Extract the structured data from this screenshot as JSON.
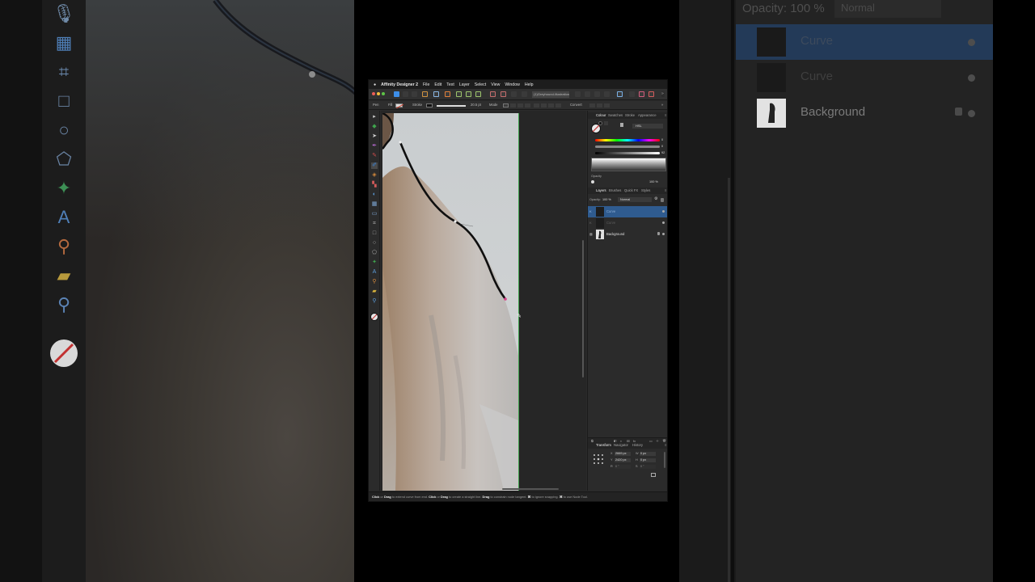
{
  "app": {
    "name": "Affinity Designer 2",
    "menu": [
      "File",
      "Edit",
      "Text",
      "Layer",
      "Select",
      "View",
      "Window",
      "Help"
    ],
    "document_name": "(1)Greyhound-illustration.af"
  },
  "context_toolbar": {
    "pen_label": "Pen",
    "fill_label": "Fill",
    "stroke_label": "Stroke",
    "stroke_width": "20.5 pt",
    "mode_label": "Mode",
    "convert_label": "Convert"
  },
  "colour_panel": {
    "tabs": [
      "Colour",
      "Swatches",
      "Stroke",
      "Appearance"
    ],
    "active_tab": "Colour",
    "model": "HSL",
    "h_value": "0",
    "s_value": "0",
    "l_value": "92",
    "opacity_label": "Opacity",
    "opacity_value": "100 %"
  },
  "layers_panel": {
    "tabs": [
      "Layers",
      "Brushes",
      "Quick FX",
      "Styles"
    ],
    "active_tab": "Layers",
    "opacity_label": "Opacity:",
    "opacity_value": "100 %",
    "blend_mode": "Normal",
    "layers": [
      {
        "name": "Curve",
        "selected": true,
        "dim": false
      },
      {
        "name": "Curve",
        "selected": false,
        "dim": true
      },
      {
        "name": "Background",
        "selected": false,
        "dim": false,
        "locked": true
      }
    ]
  },
  "transform_panel": {
    "tabs": [
      "Transform",
      "Navigator",
      "History"
    ],
    "active_tab": "Transform",
    "x_value": "2669 px",
    "y_value": "2420 px",
    "w_value": "0 px",
    "h_value": "0 px",
    "r_value": "0 °",
    "s_value": "0 °"
  },
  "status_bar": {
    "segments": [
      {
        "text": "Click",
        "bold": true
      },
      {
        "text": " or ",
        "bold": false
      },
      {
        "text": "Drag",
        "bold": true
      },
      {
        "text": " to extend curve from end. ",
        "bold": false
      },
      {
        "text": "Click",
        "bold": true
      },
      {
        "text": " or ",
        "bold": false
      },
      {
        "text": "Drag",
        "bold": true
      },
      {
        "text": " to create a straight line. ",
        "bold": false
      },
      {
        "text": "Drag",
        "bold": true
      },
      {
        "text": " to constrain node tangent. ",
        "bold": false
      },
      {
        "text": "⌘",
        "bold": true
      },
      {
        "text": " to ignore snapping. ",
        "bold": false
      },
      {
        "text": "⌘",
        "bold": true
      },
      {
        "text": " to use Node Tool.",
        "bold": false
      }
    ]
  },
  "background_zoom": {
    "opacity_label": "Opacity:",
    "opacity_value": "100 %",
    "blend_mode": "Normal",
    "layers": [
      "Curve",
      "Curve",
      "Background"
    ]
  },
  "colors": {
    "accent_blue": "#2f5b8f",
    "guide_green": "#3fa34d",
    "curve_black": "#111111",
    "node_pink": "#d8418a"
  },
  "icons": {
    "tools": [
      "move-icon",
      "node-icon",
      "pointer-icon",
      "pen-icon",
      "pencil-icon",
      "brush-icon",
      "fill-icon",
      "gradient-icon",
      "transparency-icon",
      "crop-icon",
      "rectangle-icon",
      "ellipse-icon",
      "polygon-icon",
      "text-icon",
      "eyedropper-icon",
      "ruler-icon",
      "zoom-icon"
    ]
  }
}
